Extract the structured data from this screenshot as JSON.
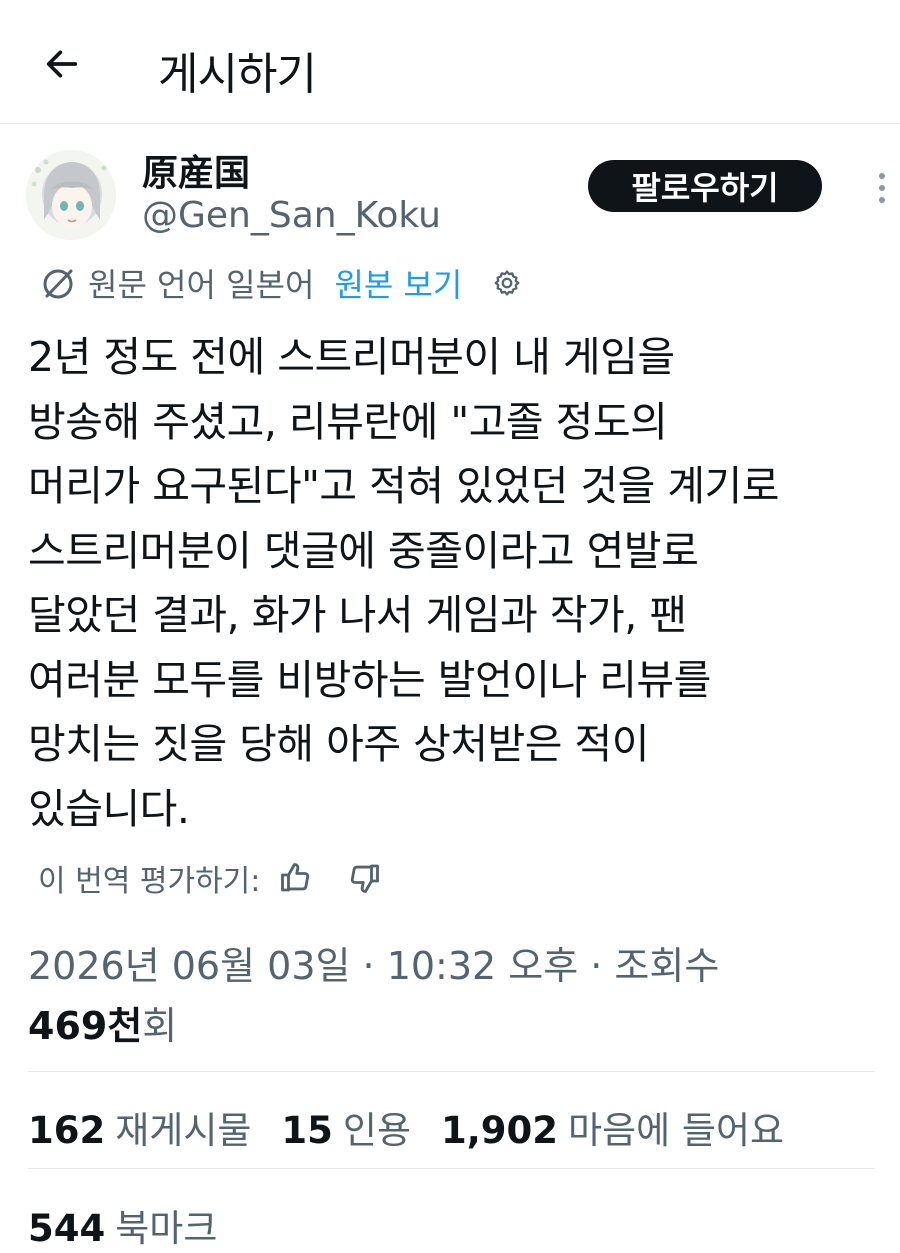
{
  "header": {
    "title": "게시하기",
    "back_icon": "arrow-left-icon"
  },
  "author": {
    "display_name": "原産国",
    "handle": "@Gen_San_Koku",
    "follow_label": "팔로우하기"
  },
  "translation": {
    "info": "원문 언어 일본어",
    "view_original": "원본 보기"
  },
  "post": {
    "lines": [
      "2년 정도 전에 스트리머분이 내 게임을",
      "방송해 주셨고, 리뷰란에 \"고졸 정도의",
      "머리가 요구된다\"고 적혀 있었던 것을 계기로",
      "스트리머분이 댓글에 중졸이라고 연발로",
      "달았던 결과, 화가 나서 게임과 작가, 팬",
      "여러분 모두를 비방하는 발언이나 리뷰를",
      "망치는 짓을 당해 아주 상처받은 적이",
      "있습니다."
    ]
  },
  "rating": {
    "label": "이 번역 평가하기:"
  },
  "meta": {
    "timestamp": "2026년 06월 03일 · 10:32 오후 · 조회수",
    "views_number": "469천",
    "views_suffix": "회"
  },
  "stats": {
    "reposts": {
      "count": "162",
      "label": "재게시물"
    },
    "quotes": {
      "count": "15",
      "label": "인용"
    },
    "likes": {
      "count": "1,902",
      "label": "마음에 들어요"
    },
    "bookmarks": {
      "count": "544",
      "label": "북마크"
    }
  },
  "colors": {
    "text": "#0f1419",
    "secondary": "#536471",
    "link": "#1d9bf0",
    "button_bg": "#0f1419",
    "divider": "#e6e8eb"
  }
}
